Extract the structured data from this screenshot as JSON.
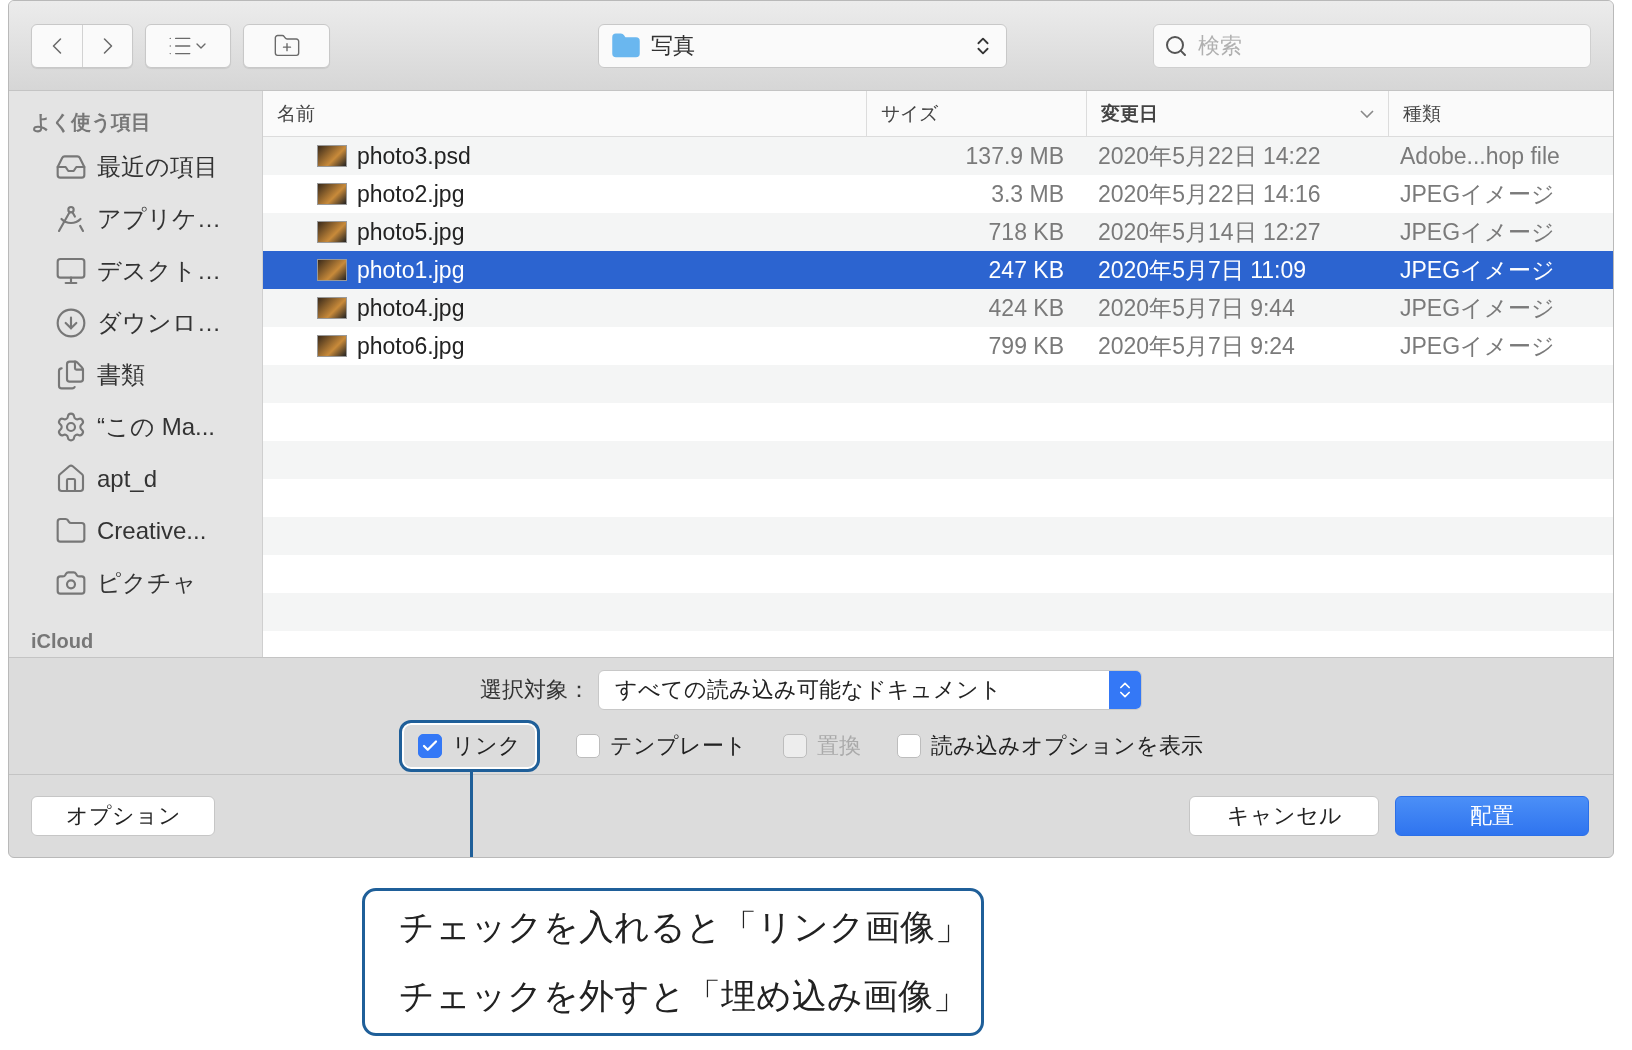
{
  "toolbar": {
    "location": "写真",
    "search": {
      "placeholder": "検索"
    }
  },
  "sidebar": {
    "sections": [
      {
        "title": "よく使う項目",
        "items": [
          {
            "label": "最近の項目"
          },
          {
            "label": "アプリケ…"
          },
          {
            "label": "デスクト…"
          },
          {
            "label": "ダウンロ…"
          },
          {
            "label": "書類"
          },
          {
            "label": "“この Ma..."
          },
          {
            "label": "apt_d"
          },
          {
            "label": "Creative..."
          },
          {
            "label": "ピクチャ"
          }
        ]
      },
      {
        "title": "iCloud"
      }
    ]
  },
  "table": {
    "columns": [
      {
        "label": "名前",
        "sorted": false
      },
      {
        "label": "サイズ",
        "sorted": false
      },
      {
        "label": "変更日",
        "sorted": true
      },
      {
        "label": "種類",
        "sorted": false
      }
    ],
    "rows": [
      {
        "name": "photo3.psd",
        "size": "137.9 MB",
        "date": "2020年5月22日 14:22",
        "kind": "Adobe...hop file",
        "selected": false
      },
      {
        "name": "photo2.jpg",
        "size": "3.3 MB",
        "date": "2020年5月22日 14:16",
        "kind": "JPEGイメージ",
        "selected": false
      },
      {
        "name": "photo5.jpg",
        "size": "718 KB",
        "date": "2020年5月14日 12:27",
        "kind": "JPEGイメージ",
        "selected": false
      },
      {
        "name": "photo1.jpg",
        "size": "247 KB",
        "date": "2020年5月7日 11:09",
        "kind": "JPEGイメージ",
        "selected": true
      },
      {
        "name": "photo4.jpg",
        "size": "424 KB",
        "date": "2020年5月7日 9:44",
        "kind": "JPEGイメージ",
        "selected": false
      },
      {
        "name": "photo6.jpg",
        "size": "799 KB",
        "date": "2020年5月7日 9:24",
        "kind": "JPEGイメージ",
        "selected": false
      }
    ]
  },
  "filter": {
    "label": "選択対象：",
    "value": "すべての読み込み可能なドキュメント"
  },
  "checkboxes": [
    {
      "label": "リンク",
      "checked": true,
      "disabled": false,
      "highlighted": true
    },
    {
      "label": "テンプレート",
      "checked": false,
      "disabled": false,
      "highlighted": false
    },
    {
      "label": "置換",
      "checked": false,
      "disabled": true,
      "highlighted": false
    },
    {
      "label": "読み込みオプションを表示",
      "checked": false,
      "disabled": false,
      "highlighted": false
    }
  ],
  "buttons": {
    "options": "オプション",
    "cancel": "キャンセル",
    "place": "配置"
  },
  "callout": {
    "lines": [
      "チェックを入れると「リンク画像」",
      "チェックを外すと「埋め込み画像」"
    ]
  }
}
